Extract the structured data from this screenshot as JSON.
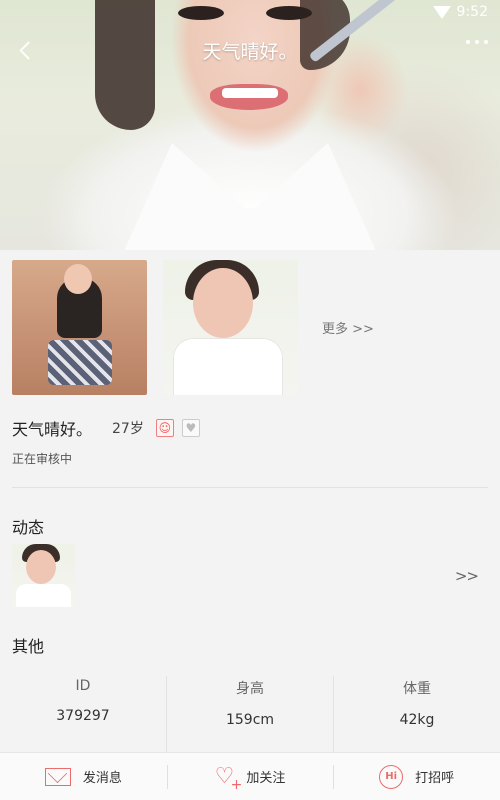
{
  "status_bar": {
    "time": "9:52"
  },
  "header": {
    "title": "天气晴好。"
  },
  "photos": {
    "more_label": "更多 >>"
  },
  "profile": {
    "name": "天气晴好。",
    "age": "27岁",
    "review_status": "正在审核中"
  },
  "dynamics": {
    "title": "动态",
    "arrow": ">>"
  },
  "other": {
    "title": "其他",
    "stats": [
      {
        "key": "ID",
        "value": "379297"
      },
      {
        "key": "身高",
        "value": "159cm"
      },
      {
        "key": "体重",
        "value": "42kg"
      }
    ]
  },
  "actions": [
    {
      "label": "发消息",
      "icon": "mail-icon"
    },
    {
      "label": "加关注",
      "icon": "heart-plus-icon"
    },
    {
      "label": "打招呼",
      "icon": "hi-icon"
    }
  ],
  "colors": {
    "accent": "#ee6b6b",
    "background": "#f3f3f3"
  }
}
